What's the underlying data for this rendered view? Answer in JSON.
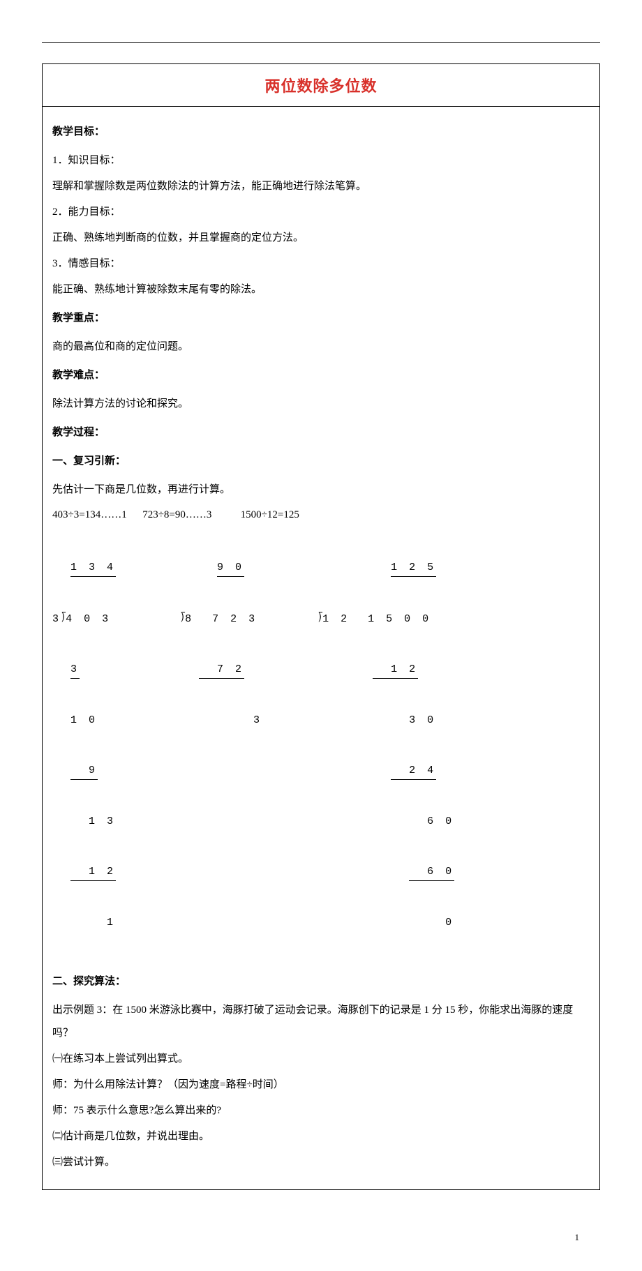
{
  "title": "两位数除多位数",
  "section1_heading": "教学目标：",
  "goal1_label": "1．知识目标：",
  "goal1_text": "理解和掌握除数是两位数除法的计算方法，能正确地进行除法笔算。",
  "goal2_label": "2．能力目标：",
  "goal2_text": "正确、熟练地判断商的位数，并且掌握商的定位方法。",
  "goal3_label": "3．情感目标：",
  "goal3_text": "能正确、熟练地计算被除数末尾有零的除法。",
  "keypoint_heading": "教学重点：",
  "keypoint_text": "商的最高位和商的定位问题。",
  "difficulty_heading": "教学难点：",
  "difficulty_text": "除法计算方法的讨论和探究。",
  "process_heading": "教学过程：",
  "review_heading": "一、复习引新：",
  "review_text": "先估计一下商是几位数，再进行计算。",
  "eq1": "403÷3=134……1",
  "eq2": "723÷8=90……3",
  "eq3": "1500÷12=125",
  "ld1": {
    "quotient": "1 3 4",
    "divisor": "3",
    "dividend": "4 0 3",
    "l1": "3",
    "l2": "1 0",
    "l3": "9",
    "l4": "1 3",
    "l5": "1 2",
    "l6": "1"
  },
  "ld2": {
    "quotient": "9 0",
    "divisor": "8",
    "dividend": "7 2 3",
    "l1": "7 2",
    "l2": "3"
  },
  "ld3": {
    "quotient": "1 2 5",
    "divisor": "1 2",
    "dividend": "1 5 0 0",
    "l1": "1 2",
    "l2": "3 0",
    "l3": "2 4",
    "l4": "6 0",
    "l5": "6 0",
    "l6": "0"
  },
  "explore_heading": "二、探究算法：",
  "explore_p1": "出示例题 3：在 1500 米游泳比赛中，海豚打破了运动会记录。海豚创下的记录是 1 分 15 秒，你能求出海豚的速度吗？",
  "explore_p2": "㈠在练习本上尝试列出算式。",
  "explore_p3": "师：为什么用除法计算？（因为速度=路程÷时间）",
  "explore_p4": "师：75 表示什么意思?怎么算出来的?",
  "explore_p5": "㈡估计商是几位数，并说出理由。",
  "explore_p6": "㈢尝试计算。",
  "page_number": "1"
}
